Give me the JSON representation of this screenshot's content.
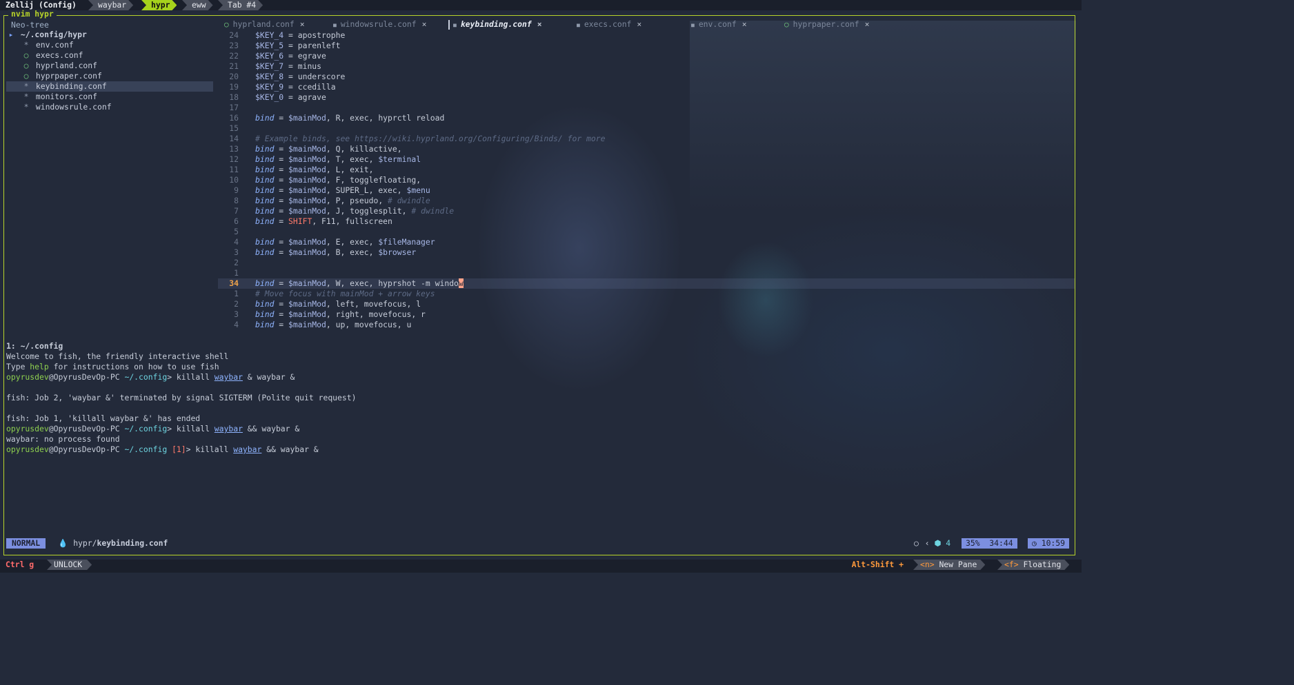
{
  "zellij": {
    "session_title": "Zellij (Config)",
    "tabs": [
      "waybar",
      "hypr",
      "eww",
      "Tab #4"
    ],
    "active_tab": "hypr"
  },
  "pane": {
    "title": "nvim hypr"
  },
  "neotree": {
    "title": "Neo-tree",
    "root": "~/.config/hypr",
    "files": [
      {
        "icon": "*",
        "name": "env.conf"
      },
      {
        "icon": "leaf",
        "name": "execs.conf"
      },
      {
        "icon": "leaf",
        "name": "hyprland.conf"
      },
      {
        "icon": "leaf",
        "name": "hyprpaper.conf"
      },
      {
        "icon": "*",
        "name": "keybinding.conf"
      },
      {
        "icon": "*",
        "name": "monitors.conf"
      },
      {
        "icon": "*",
        "name": "windowsrule.conf"
      }
    ],
    "selected": "keybinding.conf"
  },
  "buffer_tabs": [
    {
      "name": "hyprland.conf",
      "icon": "leaf"
    },
    {
      "name": "windowsrule.conf",
      "icon": "file"
    },
    {
      "name": "keybinding.conf",
      "icon": "file",
      "active": true
    },
    {
      "name": "execs.conf",
      "icon": "file"
    },
    {
      "name": "env.conf",
      "icon": "file"
    },
    {
      "name": "hyprpaper.conf",
      "icon": "leaf"
    }
  ],
  "close_glyph": "×",
  "code": {
    "lines": [
      {
        "n": "24",
        "parts": [
          [
            "var",
            "$KEY_4"
          ],
          [
            "p",
            " = apostrophe"
          ]
        ]
      },
      {
        "n": "23",
        "parts": [
          [
            "var",
            "$KEY_5"
          ],
          [
            "p",
            " = parenleft"
          ]
        ]
      },
      {
        "n": "22",
        "parts": [
          [
            "var",
            "$KEY_6"
          ],
          [
            "p",
            " = egrave"
          ]
        ]
      },
      {
        "n": "21",
        "parts": [
          [
            "var",
            "$KEY_7"
          ],
          [
            "p",
            " = minus"
          ]
        ]
      },
      {
        "n": "20",
        "parts": [
          [
            "var",
            "$KEY_8"
          ],
          [
            "p",
            " = underscore"
          ]
        ]
      },
      {
        "n": "19",
        "parts": [
          [
            "var",
            "$KEY_9"
          ],
          [
            "p",
            " = ccedilla"
          ]
        ]
      },
      {
        "n": "18",
        "parts": [
          [
            "var",
            "$KEY_0"
          ],
          [
            "p",
            " = agrave"
          ]
        ]
      },
      {
        "n": "17",
        "parts": []
      },
      {
        "n": "16",
        "parts": [
          [
            "kw",
            "bind"
          ],
          [
            "p",
            " = "
          ],
          [
            "var",
            "$mainMod"
          ],
          [
            "p",
            ", R, exec, hyprctl reload"
          ]
        ]
      },
      {
        "n": "15",
        "parts": []
      },
      {
        "n": "14",
        "parts": [
          [
            "cm",
            "# Example binds, see https://wiki.hyprland.org/Configuring/Binds/ for more"
          ]
        ]
      },
      {
        "n": "13",
        "parts": [
          [
            "kw",
            "bind"
          ],
          [
            "p",
            " = "
          ],
          [
            "var",
            "$mainMod"
          ],
          [
            "p",
            ", Q, killactive,"
          ]
        ]
      },
      {
        "n": "12",
        "parts": [
          [
            "kw",
            "bind"
          ],
          [
            "p",
            " = "
          ],
          [
            "var",
            "$mainMod"
          ],
          [
            "p",
            ", T, exec, "
          ],
          [
            "var",
            "$terminal"
          ]
        ]
      },
      {
        "n": "11",
        "parts": [
          [
            "kw",
            "bind"
          ],
          [
            "p",
            " = "
          ],
          [
            "var",
            "$mainMod"
          ],
          [
            "p",
            ", L, exit,"
          ]
        ]
      },
      {
        "n": "10",
        "parts": [
          [
            "kw",
            "bind"
          ],
          [
            "p",
            " = "
          ],
          [
            "var",
            "$mainMod"
          ],
          [
            "p",
            ", F, togglefloating,"
          ]
        ]
      },
      {
        "n": "9",
        "parts": [
          [
            "kw",
            "bind"
          ],
          [
            "p",
            " = "
          ],
          [
            "var",
            "$mainMod"
          ],
          [
            "p",
            ", SUPER_L, exec, "
          ],
          [
            "var",
            "$menu"
          ]
        ]
      },
      {
        "n": "8",
        "parts": [
          [
            "kw",
            "bind"
          ],
          [
            "p",
            " = "
          ],
          [
            "var",
            "$mainMod"
          ],
          [
            "p",
            ", P, pseudo, "
          ],
          [
            "cm",
            "# dwindle"
          ]
        ]
      },
      {
        "n": "7",
        "parts": [
          [
            "kw",
            "bind"
          ],
          [
            "p",
            " = "
          ],
          [
            "var",
            "$mainMod"
          ],
          [
            "p",
            ", J, togglesplit, "
          ],
          [
            "cm",
            "# dwindle"
          ]
        ]
      },
      {
        "n": "6",
        "parts": [
          [
            "kw",
            "bind"
          ],
          [
            "p",
            " = "
          ],
          [
            "red",
            "SHIFT"
          ],
          [
            "p",
            ", F11, fullscreen"
          ]
        ]
      },
      {
        "n": "5",
        "parts": []
      },
      {
        "n": "4",
        "parts": [
          [
            "kw",
            "bind"
          ],
          [
            "p",
            " = "
          ],
          [
            "var",
            "$mainMod"
          ],
          [
            "p",
            ", E, exec, "
          ],
          [
            "var",
            "$fileManager"
          ]
        ]
      },
      {
        "n": "3",
        "parts": [
          [
            "kw",
            "bind"
          ],
          [
            "p",
            " = "
          ],
          [
            "var",
            "$mainMod"
          ],
          [
            "p",
            ", B, exec, "
          ],
          [
            "var",
            "$browser"
          ]
        ]
      },
      {
        "n": "2",
        "parts": []
      },
      {
        "n": "1",
        "parts": []
      },
      {
        "n": "34",
        "cur": true,
        "parts": [
          [
            "kw",
            "bind"
          ],
          [
            "p",
            " = "
          ],
          [
            "var",
            "$mainMod"
          ],
          [
            "p",
            ", W, exec, hyprshot -m windo"
          ],
          [
            "cursor",
            "w"
          ]
        ]
      },
      {
        "n": "1",
        "parts": [
          [
            "cm",
            "# Move focus with mainMod + arrow keys"
          ]
        ]
      },
      {
        "n": "2",
        "parts": [
          [
            "kw",
            "bind"
          ],
          [
            "p",
            " = "
          ],
          [
            "var",
            "$mainMod"
          ],
          [
            "p",
            ", left, movefocus, l"
          ]
        ]
      },
      {
        "n": "3",
        "parts": [
          [
            "kw",
            "bind"
          ],
          [
            "p",
            " = "
          ],
          [
            "var",
            "$mainMod"
          ],
          [
            "p",
            ", right, movefocus, r"
          ]
        ]
      },
      {
        "n": "4",
        "parts": [
          [
            "kw",
            "bind"
          ],
          [
            "p",
            " = "
          ],
          [
            "var",
            "$mainMod"
          ],
          [
            "p",
            ", up, movefocus, u"
          ]
        ]
      }
    ]
  },
  "terminal": {
    "lines": [
      {
        "bold": true,
        "parts": [
          [
            "p",
            "1: ~/.config"
          ]
        ]
      },
      {
        "parts": [
          [
            "p",
            "Welcome to fish, the friendly interactive shell"
          ]
        ]
      },
      {
        "parts": [
          [
            "p",
            "Type "
          ],
          [
            "green",
            "help"
          ],
          [
            "p",
            " for instructions on how to use fish"
          ]
        ]
      },
      {
        "parts": [
          [
            "green",
            "opyrusdev"
          ],
          [
            "p",
            "@OpyrusDevOp-PC "
          ],
          [
            "cyan",
            "~/.config"
          ],
          [
            "p",
            "> killall "
          ],
          [
            "ul",
            "waybar"
          ],
          [
            "p",
            " & waybar &"
          ]
        ]
      },
      {
        "parts": []
      },
      {
        "parts": [
          [
            "p",
            "fish: Job 2, 'waybar &' terminated by signal SIGTERM (Polite quit request)"
          ]
        ]
      },
      {
        "parts": []
      },
      {
        "parts": [
          [
            "p",
            "fish: Job 1, 'killall waybar &' has ended"
          ]
        ]
      },
      {
        "parts": [
          [
            "green",
            "opyrusdev"
          ],
          [
            "p",
            "@OpyrusDevOp-PC "
          ],
          [
            "cyan",
            "~/.config"
          ],
          [
            "p",
            "> killall "
          ],
          [
            "ul",
            "waybar"
          ],
          [
            "p",
            " && waybar &"
          ]
        ]
      },
      {
        "parts": [
          [
            "p",
            "waybar: no process found"
          ]
        ]
      },
      {
        "parts": [
          [
            "green",
            "opyrusdev"
          ],
          [
            "p",
            "@OpyrusDevOp-PC "
          ],
          [
            "cyan",
            "~/.config"
          ],
          [
            "p",
            " "
          ],
          [
            "red",
            "[1]"
          ],
          [
            "p",
            "> killall "
          ],
          [
            "ul",
            "waybar"
          ],
          [
            "p",
            " && waybar &"
          ]
        ]
      }
    ]
  },
  "statusline": {
    "mode": "NORMAL",
    "dir": "hypr/",
    "file": "keybinding.conf",
    "lsp_count": "4",
    "percent": "35%",
    "position": "34:44",
    "clock": "10:59"
  },
  "bottom": {
    "ctrl": "Ctrl g",
    "unlock": "UNLOCK",
    "alt": "Alt-Shift +",
    "hints": [
      {
        "key": "<n>",
        "label": "New Pane"
      },
      {
        "key": "<f>",
        "label": "Floating"
      }
    ]
  },
  "colors": {
    "accent": "#b8d42a",
    "active_tab": "#a6d21c",
    "mode": "#7c8fe0"
  }
}
